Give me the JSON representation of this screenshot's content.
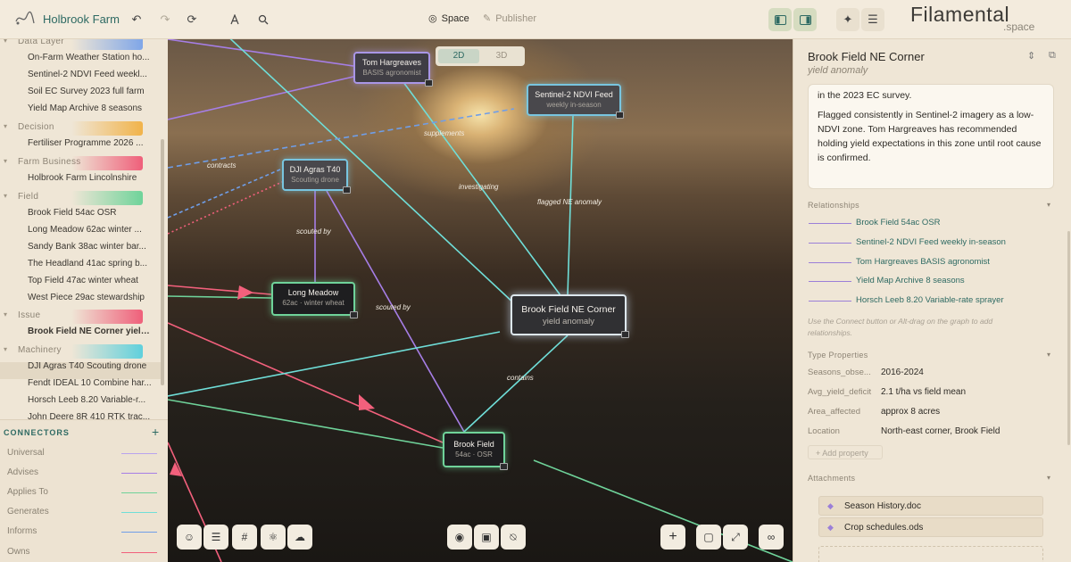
{
  "app": {
    "title": "Holbrook Farm"
  },
  "topbar": {
    "space_label": "Space",
    "publisher_label": "Publisher",
    "brand_main": "Filamental",
    "brand_sub": ".space"
  },
  "sidebar": {
    "groups": [
      {
        "label": "Data Layer",
        "color": "#7fa6e8",
        "items": [
          "On-Farm Weather Station ho...",
          "Sentinel-2 NDVI Feed weekl...",
          "Soil EC Survey 2023 full farm",
          "Yield Map Archive 8 seasons"
        ]
      },
      {
        "label": "Decision",
        "color": "#f1b34a",
        "items": [
          "Fertiliser Programme 2026 ..."
        ]
      },
      {
        "label": "Farm Business",
        "color": "#ef5f7a",
        "items": [
          "Holbrook Farm Lincolnshire"
        ]
      },
      {
        "label": "Field",
        "color": "#6fd39a",
        "items": [
          "Brook Field 54ac OSR",
          "Long Meadow 62ac winter ...",
          "Sandy Bank 38ac winter bar...",
          "The Headland 41ac spring b...",
          "Top Field 47ac winter wheat",
          "West Piece 29ac stewardship"
        ]
      },
      {
        "label": "Issue",
        "color": "#ef5f7a",
        "items": [
          "Brook Field NE Corner yield..."
        ]
      },
      {
        "label": "Machinery",
        "color": "#5fd0dc",
        "items": [
          "DJI Agras T40 Scouting drone",
          "Fendt IDEAL 10 Combine har...",
          "Horsch Leeb 8.20 Variable-r...",
          "John Deere 8R 410 RTK trac..."
        ]
      }
    ]
  },
  "connectors": {
    "title": "CONNECTORS",
    "items": [
      {
        "label": "Universal",
        "color": "#b9a3ee"
      },
      {
        "label": "Advises",
        "color": "#a67ee6"
      },
      {
        "label": "Applies To",
        "color": "#6fd39a"
      },
      {
        "label": "Generates",
        "color": "#6fded8"
      },
      {
        "label": "Informs",
        "color": "#6f9ee8"
      },
      {
        "label": "Owns",
        "color": "#f2607c"
      }
    ]
  },
  "canvas": {
    "view_toggle": {
      "a": "2D",
      "b": "3D"
    },
    "nodes": [
      {
        "title": "Tom Hargreaves",
        "subtitle": "BASIS agronomist"
      },
      {
        "title": "Sentinel-2 NDVI Feed",
        "subtitle": "weekly in-season"
      },
      {
        "title": "DJI Agras T40",
        "subtitle": "Scouting drone"
      },
      {
        "title": "Long Meadow",
        "subtitle": "62ac · winter wheat"
      },
      {
        "title": "Brook Field NE Corner",
        "subtitle": "yield anomaly"
      },
      {
        "title": "Brook Field",
        "subtitle": "54ac · OSR"
      }
    ],
    "edge_labels": [
      "supplements",
      "contracts",
      "investigating",
      "flagged NE anomaly",
      "scouted by",
      "scouted by",
      "contains"
    ]
  },
  "panel": {
    "title": "Brook Field NE Corner",
    "subtitle": "yield anomaly",
    "desc_top": "in the 2023 EC survey.",
    "desc_main": "Flagged consistently in Sentinel-2 imagery as a low-NDVI zone. Tom Hargreaves has recommended holding yield expectations in this zone until root cause is confirmed.",
    "relationships_label": "Relationships",
    "relationships": [
      "Brook Field 54ac OSR",
      "Sentinel-2 NDVI Feed weekly in-season",
      "Tom Hargreaves BASIS agronomist",
      "Yield Map Archive 8 seasons",
      "Horsch Leeb 8.20 Variable-rate sprayer"
    ],
    "hint": "Use the Connect button or Alt-drag on the graph to add relationships.",
    "type_props_label": "Type Properties",
    "props": [
      {
        "key": "Seasons_obse...",
        "value": "2016-2024"
      },
      {
        "key": "Avg_yield_deficit",
        "value": "2.1 t/ha vs field mean"
      },
      {
        "key": "Area_affected",
        "value": "approx 8 acres"
      },
      {
        "key": "Location",
        "value": "North-east corner, Brook Field"
      }
    ],
    "add_property": "+ Add property",
    "attachments_label": "Attachments",
    "attachments": [
      "Season History.doc",
      "Crop schedules.ods"
    ]
  }
}
